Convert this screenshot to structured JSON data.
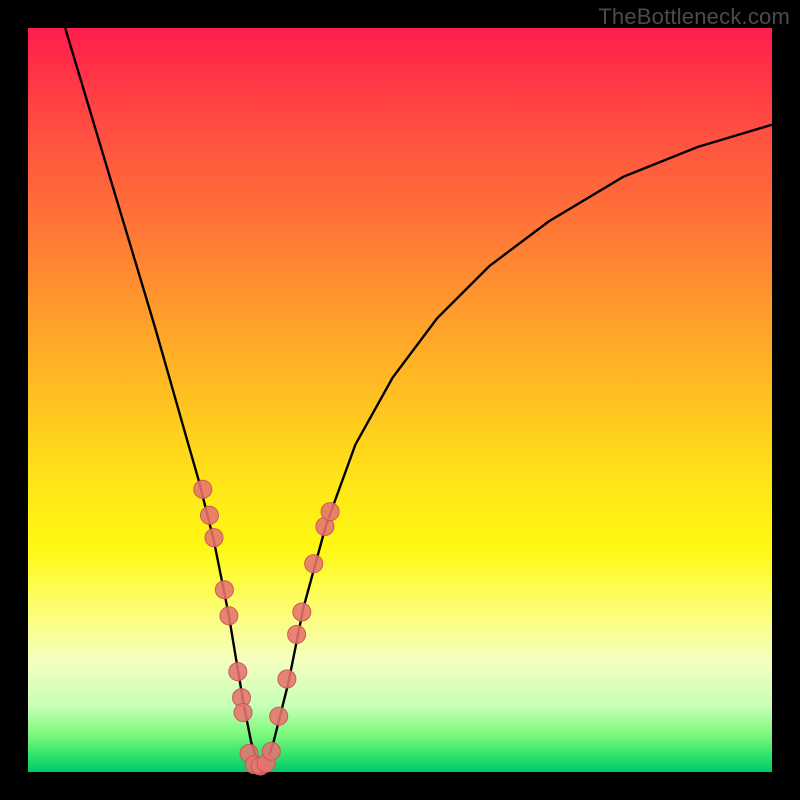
{
  "watermark": "TheBottleneck.com",
  "colors": {
    "frame": "#000000",
    "curve": "#000000",
    "marker_fill": "#e6736f",
    "marker_stroke": "#c85a56"
  },
  "chart_data": {
    "type": "line",
    "title": "",
    "xlabel": "",
    "ylabel": "",
    "xlim": [
      0,
      100
    ],
    "ylim": [
      0,
      100
    ],
    "grid": false,
    "series": [
      {
        "name": "bottleneck-curve",
        "x": [
          5,
          8,
          11,
          14,
          17,
          19,
          21,
          23,
          25,
          27,
          28,
          29,
          30,
          31,
          32,
          33,
          35,
          37,
          40,
          44,
          49,
          55,
          62,
          70,
          80,
          90,
          100
        ],
        "y": [
          100,
          90,
          80,
          70,
          60,
          53,
          46,
          39,
          31,
          21,
          15,
          9,
          4,
          1,
          1,
          4,
          12,
          22,
          33,
          44,
          53,
          61,
          68,
          74,
          80,
          84,
          87
        ]
      }
    ],
    "markers": {
      "name": "highlighted-points",
      "x_scale_note": "percent of plot width from left",
      "y_scale_note": "percent of plot height from bottom",
      "points": [
        {
          "x": 23.5,
          "y": 38.0
        },
        {
          "x": 24.4,
          "y": 34.5
        },
        {
          "x": 25.0,
          "y": 31.5
        },
        {
          "x": 26.4,
          "y": 24.5
        },
        {
          "x": 27.0,
          "y": 21.0
        },
        {
          "x": 28.2,
          "y": 13.5
        },
        {
          "x": 28.7,
          "y": 10.0
        },
        {
          "x": 28.9,
          "y": 8.0
        },
        {
          "x": 29.7,
          "y": 2.5
        },
        {
          "x": 30.4,
          "y": 1.0
        },
        {
          "x": 31.2,
          "y": 0.8
        },
        {
          "x": 32.0,
          "y": 1.2
        },
        {
          "x": 32.7,
          "y": 2.8
        },
        {
          "x": 33.7,
          "y": 7.5
        },
        {
          "x": 34.8,
          "y": 12.5
        },
        {
          "x": 36.1,
          "y": 18.5
        },
        {
          "x": 36.8,
          "y": 21.5
        },
        {
          "x": 38.4,
          "y": 28.0
        },
        {
          "x": 39.9,
          "y": 33.0
        },
        {
          "x": 40.6,
          "y": 35.0
        }
      ]
    }
  }
}
